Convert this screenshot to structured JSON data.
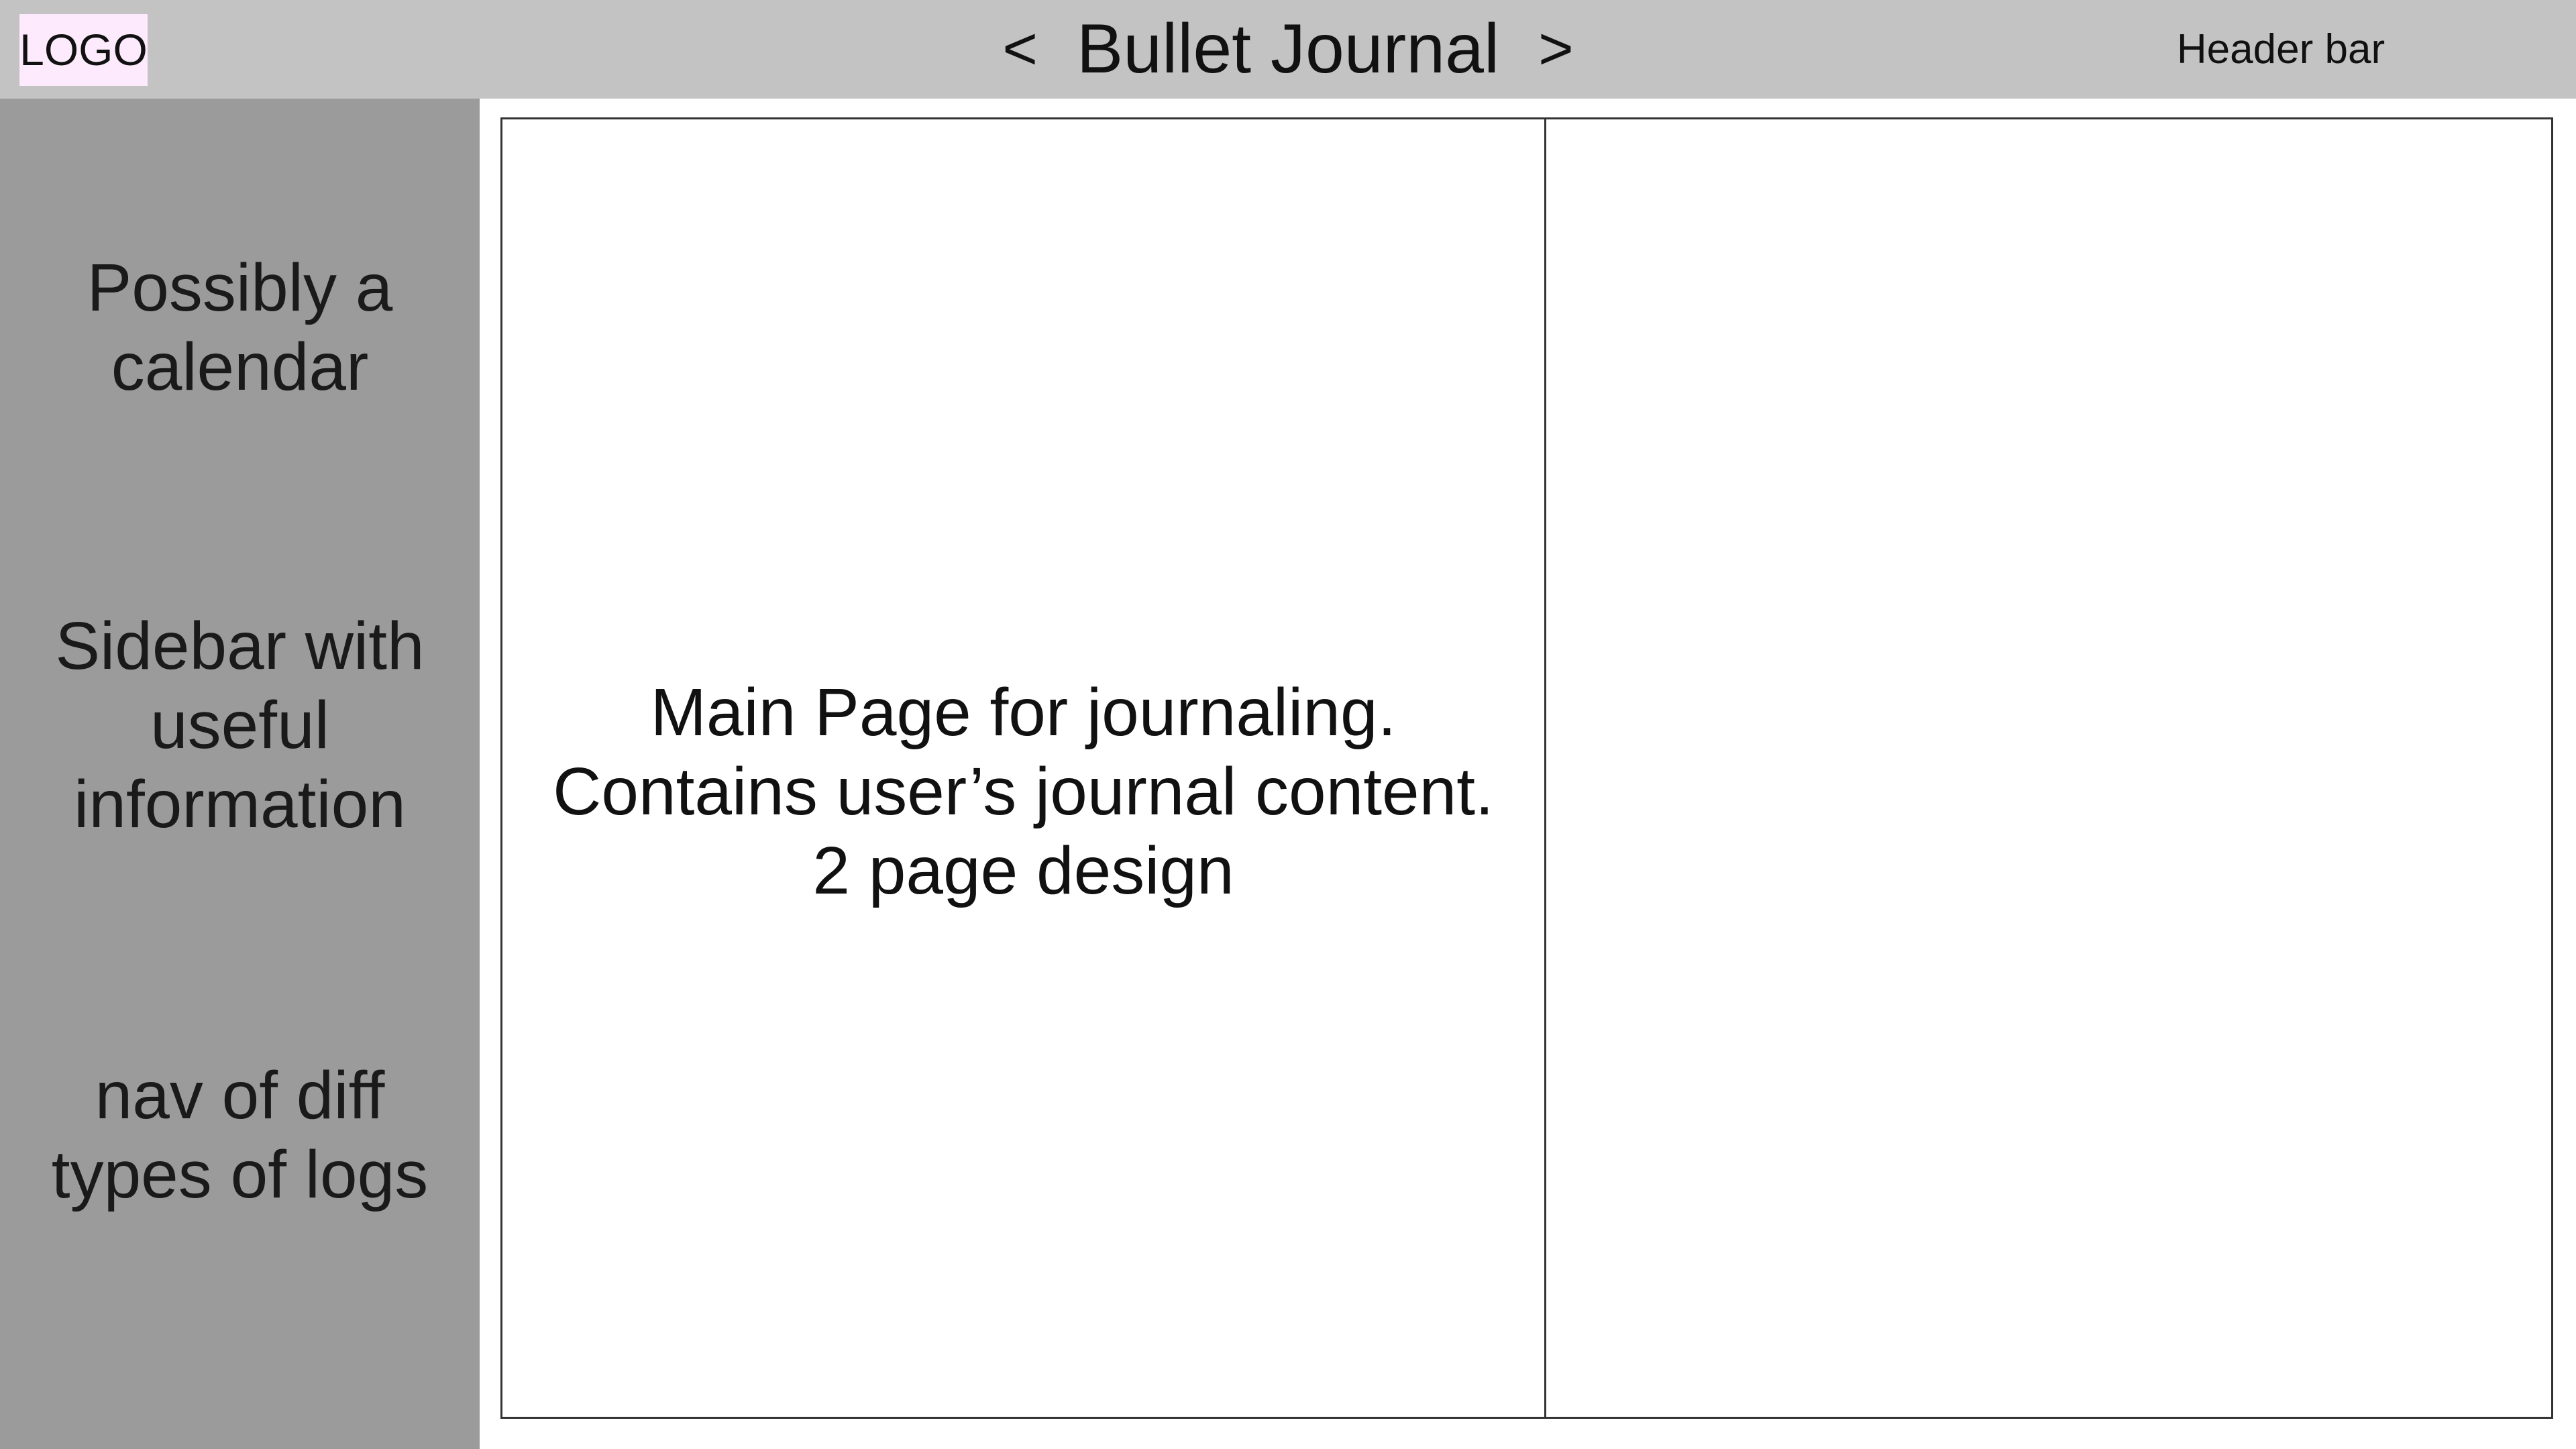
{
  "header": {
    "logo": "LOGO",
    "prev": "<",
    "title": "Bullet Journal",
    "next": ">",
    "label": "Header bar"
  },
  "sidebar": {
    "sections": [
      [
        "Possibly a",
        "calendar"
      ],
      [
        "Sidebar with",
        "useful",
        "information"
      ],
      [
        "nav of diff",
        "types of logs"
      ]
    ]
  },
  "journal": {
    "left_page": [
      "Main Page for journaling.",
      "Contains user’s journal content.",
      "2 page design"
    ],
    "right_page": []
  },
  "colors": {
    "header_bg": "#c3c3c3",
    "sidebar_bg": "#9b9b9b",
    "logo_bg": "#fdeafc",
    "page_bg": "#ffffff",
    "border": "#333333"
  }
}
